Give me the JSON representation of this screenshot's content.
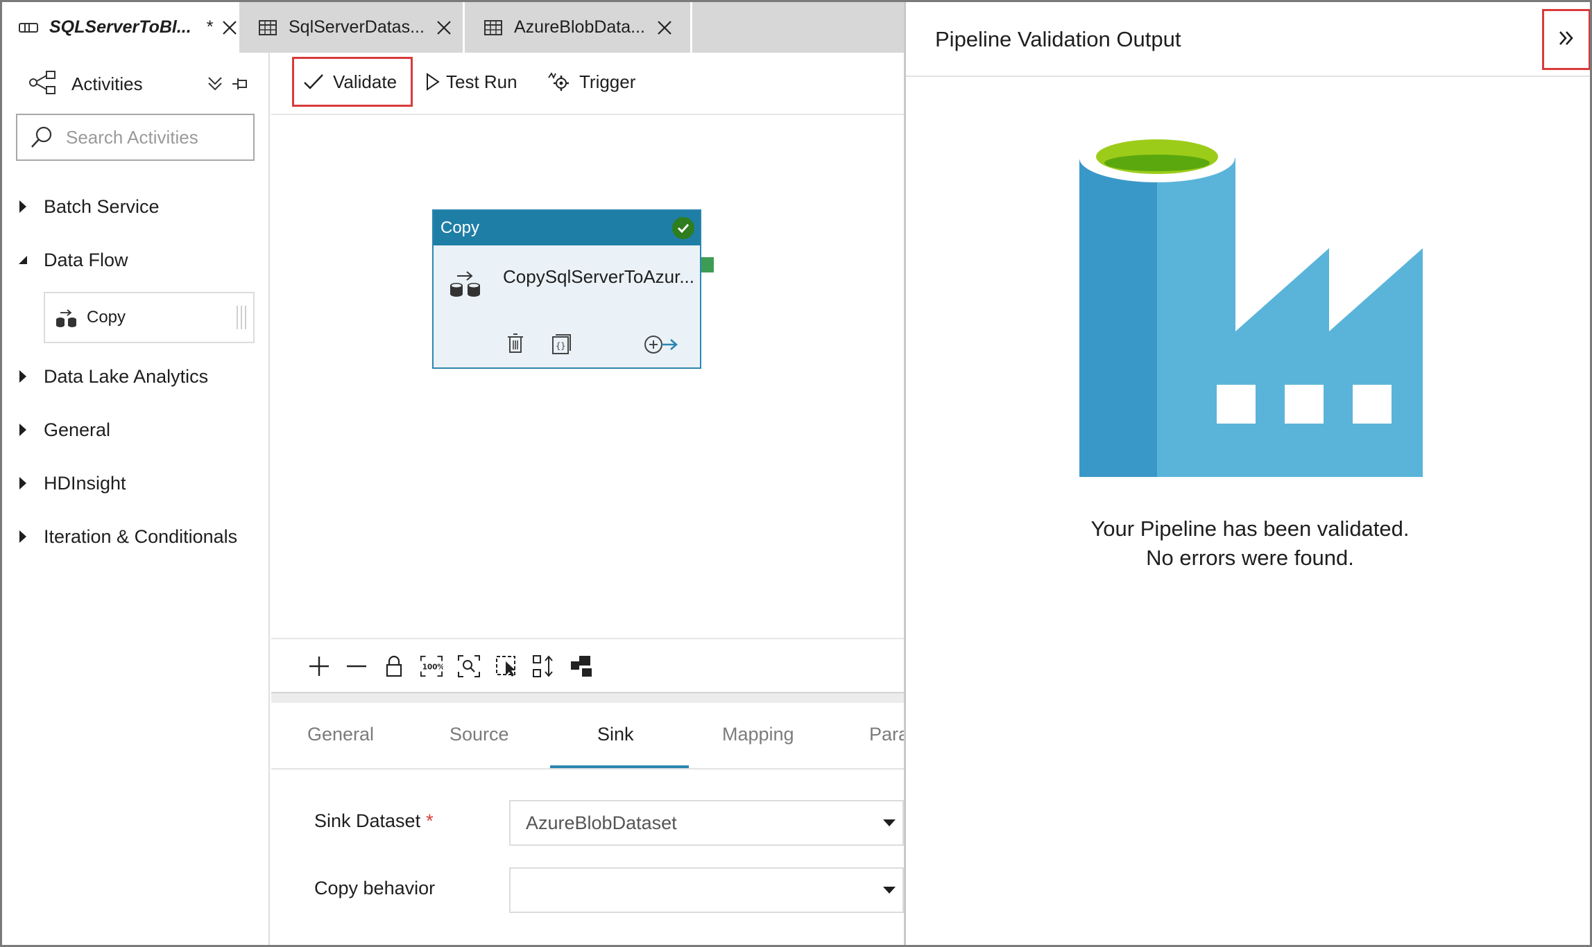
{
  "tabs": [
    {
      "label": "SQLServerToBl...",
      "dirty": "*",
      "active": true,
      "icon": "pipeline-icon"
    },
    {
      "label": "SqlServerDatas...",
      "active": false,
      "icon": "table-icon"
    },
    {
      "label": "AzureBlobData...",
      "active": false,
      "icon": "table-icon"
    }
  ],
  "sidebar": {
    "title": "Activities",
    "search_placeholder": "Search Activities",
    "categories": [
      {
        "label": "Batch Service",
        "expanded": false
      },
      {
        "label": "Data Flow",
        "expanded": true
      },
      {
        "label": "Data Lake Analytics",
        "expanded": false
      },
      {
        "label": "General",
        "expanded": false
      },
      {
        "label": "HDInsight",
        "expanded": false
      },
      {
        "label": "Iteration & Conditionals",
        "expanded": false
      }
    ],
    "dataflow_items": [
      {
        "label": "Copy"
      }
    ]
  },
  "toolbar": {
    "validate": "Validate",
    "test_run": "Test Run",
    "trigger": "Trigger"
  },
  "canvas": {
    "activity": {
      "type": "Copy",
      "name": "CopySqlServerToAzur...",
      "status": "valid"
    }
  },
  "properties": {
    "tabs": [
      "General",
      "Source",
      "Sink",
      "Mapping",
      "Para"
    ],
    "active_tab": "Sink",
    "sink_dataset_label": "Sink Dataset",
    "required_marker": "*",
    "sink_dataset_value": "AzureBlobDataset",
    "copy_behavior_label": "Copy behavior",
    "copy_behavior_value": ""
  },
  "validation_panel": {
    "title": "Pipeline Validation Output",
    "message_line1": "Your Pipeline has been validated.",
    "message_line2": "No errors were found."
  },
  "colors": {
    "accent_blue": "#1f7ea6",
    "highlight_red": "#d93a3a",
    "success_green": "#2e7d1e",
    "factory_dark": "#3a98c9",
    "factory_light": "#5ab4da",
    "factory_top": "#9ccc1a"
  }
}
